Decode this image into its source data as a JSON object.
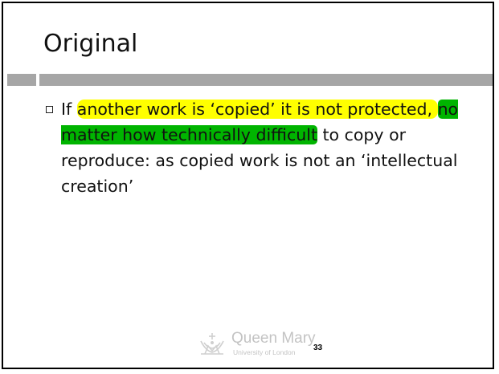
{
  "slide": {
    "title": "Original",
    "bullet": {
      "segments": [
        {
          "text": "If ",
          "highlight": "none"
        },
        {
          "text": "another work is ‘copied’ it is not protected, ",
          "highlight": "yellow"
        },
        {
          "text": "no matter how technically difficult",
          "highlight": "green"
        },
        {
          "text": " to copy or reproduce: as copied work is not an ‘intellectual creation’",
          "highlight": "none"
        }
      ]
    },
    "footer": {
      "logo_name": "Queen Mary",
      "logo_subtitle": "University of London",
      "page_number": "33"
    }
  },
  "colors": {
    "highlight_yellow": "#ffff00",
    "highlight_green": "#00b400",
    "title_rule": "#a6a6a6",
    "frame": "#000000"
  },
  "icons": {
    "bullet": "hollow-square-bullet-icon",
    "logo": "queen-mary-crown-logo-icon"
  }
}
